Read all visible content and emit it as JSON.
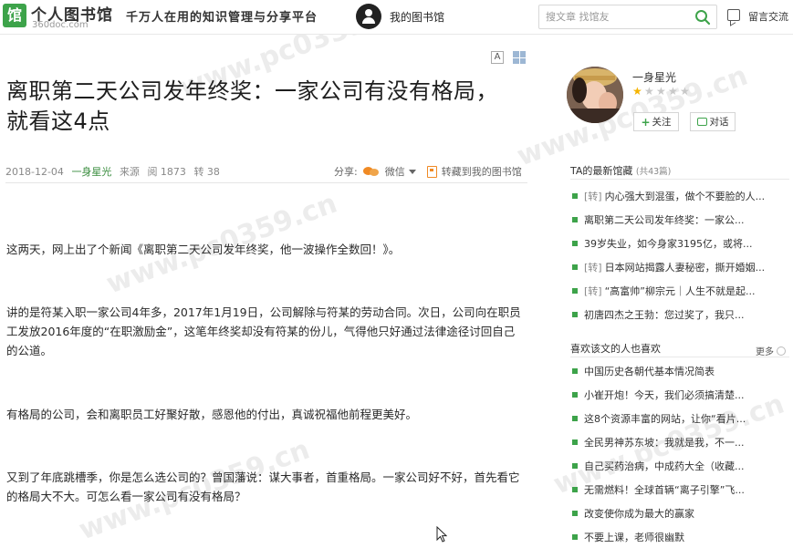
{
  "header": {
    "logo_name": "个人图书馆",
    "logo_domain": "360doc.com",
    "slogan": "千万人在用的知识管理与分享平台",
    "mylib_label": "我的图书馆",
    "search_placeholder": "搜文章 找馆友",
    "message_label": "留言交流"
  },
  "article": {
    "font_button": "A",
    "title": "离职第二天公司发年终奖：一家公司有没有格局，就看这4点",
    "date": "2018-12-04",
    "author": "一身星光",
    "source_label": "来源",
    "views_label": "阅 1873",
    "reposts_label": "转 38",
    "share_label": "分享:",
    "wechat_label": "微信",
    "save_label": "转藏到我的图书馆",
    "paragraphs": [
      "这两天，网上出了个新闻《离职第二天公司发年终奖，他一波操作全数回！》。",
      "讲的是符某入职一家公司4年多，2017年1月19日，公司解除与符某的劳动合同。次日，公司向在职员工发放2016年度的“在职激励金”，这笔年终奖却没有符某的份儿，气得他只好通过法律途径讨回自己的公道。",
      "有格局的公司，会和离职员工好聚好散，感恩他的付出，真诚祝福他前程更美好。",
      "又到了年底跳槽季，你是怎么选公司的？曾国藩说：谋大事者，首重格局。一家公司好不好，首先看它的格局大不大。可怎么看一家公司有没有格局？"
    ]
  },
  "sidebar": {
    "username": "一身星光",
    "rating": 1,
    "rating_max": 5,
    "follow_label": "关注",
    "chat_label": "对话",
    "latest_heading": "TA的最新馆藏",
    "latest_count": "(共43篇)",
    "latest_items": [
      {
        "tag": "[转]",
        "text": "内心强大到混蛋，做个不要脸的人..."
      },
      {
        "tag": "",
        "text": "离职第二天公司发年终奖：一家公..."
      },
      {
        "tag": "",
        "text": "39岁失业，如今身家3195亿，或将..."
      },
      {
        "tag": "[转]",
        "text": "日本网站揭露人妻秘密，撕开婚姻..."
      },
      {
        "tag": "[转]",
        "text": "“高富帅”柳宗元｜人生不就是起..."
      },
      {
        "tag": "",
        "text": "初唐四杰之王勃：您过奖了，我只..."
      }
    ],
    "liked_heading": "喜欢该文的人也喜欢",
    "more_label": "更多",
    "liked_items": [
      "中国历史各朝代基本情况简表",
      "小崔开炮！今天，我们必须搞清楚...",
      "这8个资源丰富的网站，让你“看片...",
      "全民男神苏东坡：我就是我，不一...",
      "自己买药治病，中成药大全（收藏...",
      "无需燃料！全球首辆“离子引擎”飞...",
      "改变使你成为最大的赢家",
      "不要上课，老师很幽默"
    ]
  },
  "colors": {
    "brand_green": "#3da34a",
    "share_orange": "#f08a24",
    "star_gold": "#f5b400"
  }
}
